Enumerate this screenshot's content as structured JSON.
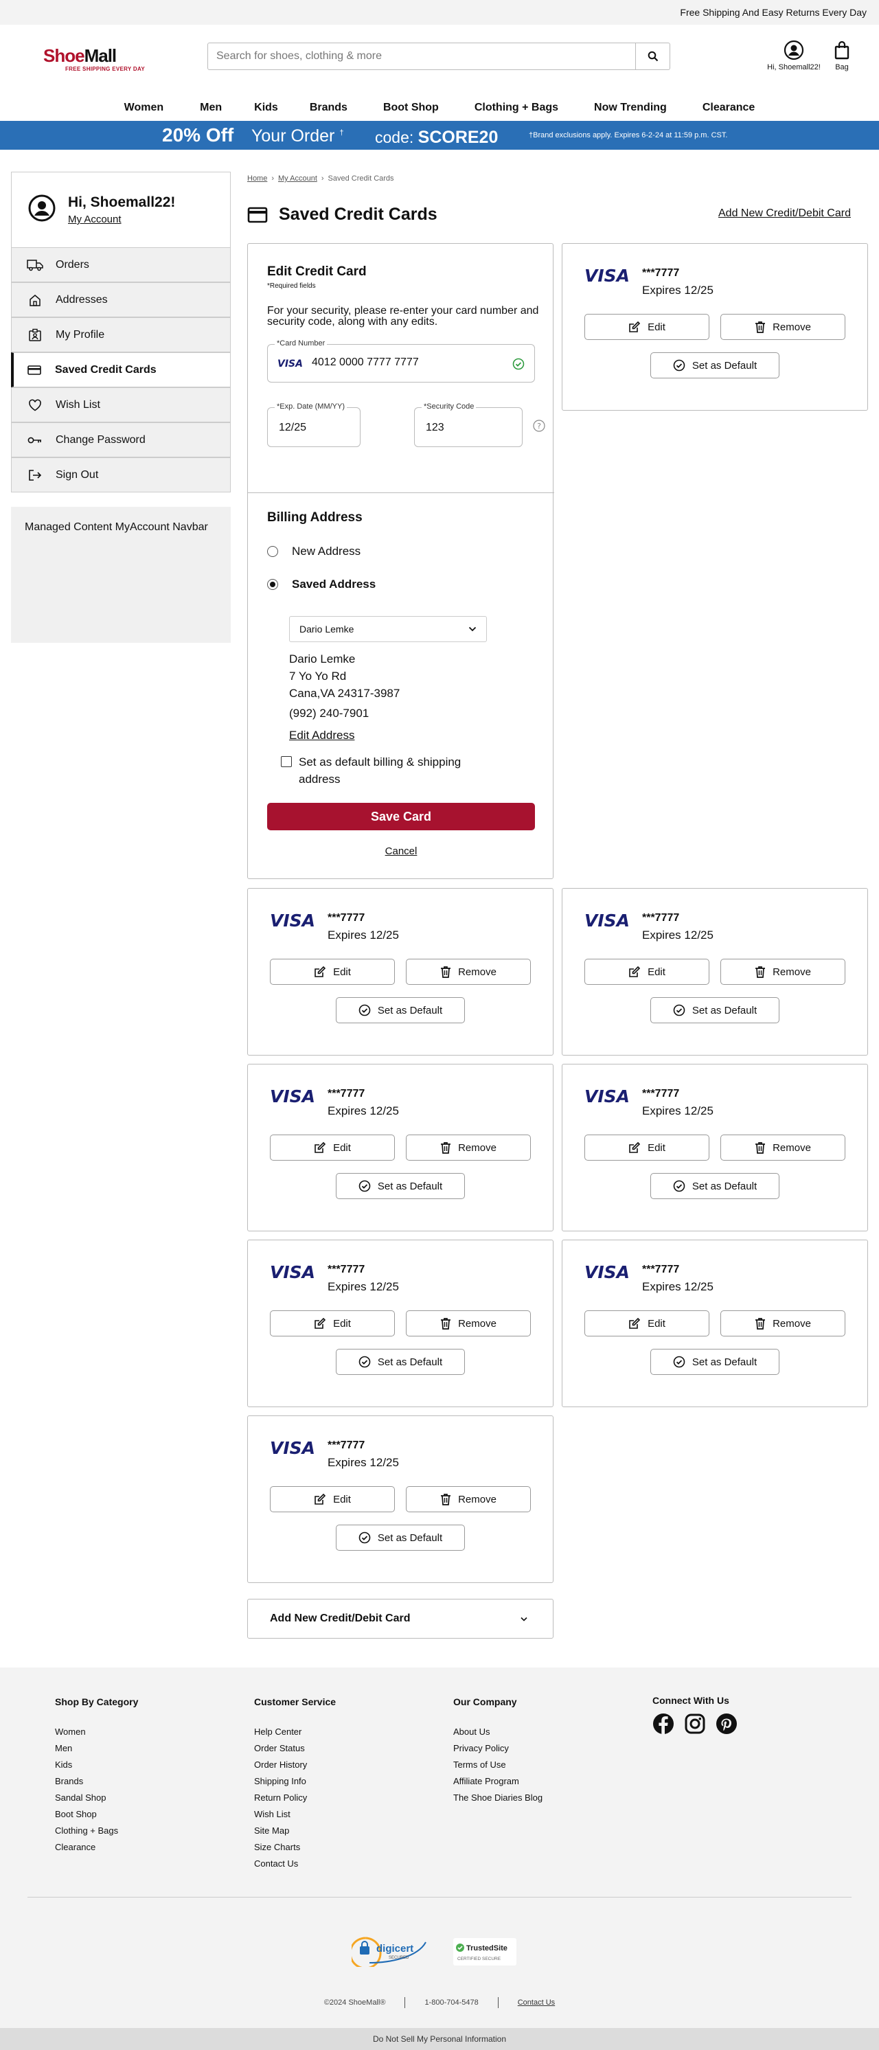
{
  "topbar": {
    "text": "Free Shipping And Easy Returns Every Day"
  },
  "logo": {
    "brand_a": "Shoe",
    "brand_b": "Mall",
    "tagline": "FREE SHIPPING EVERY DAY"
  },
  "search": {
    "placeholder": "Search for shoes, clothing & more"
  },
  "account": {
    "label": "Hi, Shoemall22!"
  },
  "bag": {
    "label": "Bag"
  },
  "nav": {
    "items": [
      "Women",
      "Men",
      "Kids",
      "Brands",
      "Boot Shop",
      "Clothing + Bags",
      "Now Trending",
      "Clearance"
    ]
  },
  "promo": {
    "off": "20% Off",
    "order": "Your Order",
    "dagger": "†",
    "code_label": "code:",
    "code": "SCORE20",
    "fine": "†Brand exclusions apply. Expires 6-2-24 at 11:59 p.m. CST."
  },
  "sidebar": {
    "greeting": "Hi, Shoemall22!",
    "my_account": "My Account",
    "items": [
      {
        "label": "Orders",
        "icon": "truck-icon"
      },
      {
        "label": "Addresses",
        "icon": "home-icon"
      },
      {
        "label": "My Profile",
        "icon": "id-badge-icon"
      },
      {
        "label": "Saved Credit Cards",
        "icon": "credit-card-icon",
        "active": true
      },
      {
        "label": "Wish List",
        "icon": "heart-icon"
      },
      {
        "label": "Change Password",
        "icon": "key-icon"
      },
      {
        "label": "Sign Out",
        "icon": "sign-out-icon"
      }
    ],
    "managed": "Managed Content MyAccount Navbar"
  },
  "breadcrumb": {
    "home": "Home",
    "account": "My Account",
    "current": "Saved Credit Cards"
  },
  "page": {
    "title": "Saved Credit Cards",
    "add_link": "Add New Credit/Debit Card"
  },
  "edit_card": {
    "title": "Edit Credit Card",
    "required": "*Required fields",
    "note": "For your security, please re-enter your card number and security code, along with any edits.",
    "card_number_label": "*Card Number",
    "card_number": "4012 0000 7777 7777",
    "exp_label": "*Exp. Date (MM/YY)",
    "exp": "12/25",
    "sec_label": "*Security Code",
    "sec": "123",
    "billing_title": "Billing Address",
    "new_address": "New Address",
    "saved_address": "Saved Address",
    "selected_address": "Dario Lemke",
    "address": {
      "name": "Dario Lemke",
      "street": "7 Yo Yo Rd",
      "city": "Cana,VA 24317-3987",
      "phone": "(992) 240-7901"
    },
    "edit_address": "Edit Address",
    "default_checkbox": "Set as default billing & shipping address",
    "save": "Save Card",
    "cancel": "Cancel"
  },
  "card_labels": {
    "edit": "Edit",
    "remove": "Remove",
    "default": "Set as Default",
    "brand": "VISA"
  },
  "cards": [
    {
      "number": "***7777",
      "expires": "Expires 12/25"
    },
    {
      "number": "***7777",
      "expires": "Expires 12/25"
    },
    {
      "number": "***7777",
      "expires": "Expires 12/25"
    },
    {
      "number": "***7777",
      "expires": "Expires 12/25"
    },
    {
      "number": "***7777",
      "expires": "Expires 12/25"
    },
    {
      "number": "***7777",
      "expires": "Expires 12/25"
    },
    {
      "number": "***7777",
      "expires": "Expires 12/25"
    },
    {
      "number": "***7777",
      "expires": "Expires 12/25"
    }
  ],
  "add_new_accordion": "Add New Credit/Debit Card",
  "footer": {
    "shop": {
      "title": "Shop By Category",
      "links": [
        "Women",
        "Men",
        "Kids",
        "Brands",
        "Sandal Shop",
        "Boot Shop",
        "Clothing + Bags",
        "Clearance"
      ]
    },
    "service": {
      "title": "Customer Service",
      "links": [
        "Help Center",
        "Order Status",
        "Order History",
        "Shipping Info",
        "Return Policy",
        "Wish List",
        "Site Map",
        "Size Charts",
        "Contact Us"
      ]
    },
    "company": {
      "title": "Our Company",
      "links": [
        "About Us",
        "Privacy Policy",
        "Terms of Use",
        "Affiliate Program",
        "The Shoe Diaries Blog"
      ]
    },
    "connect": {
      "title": "Connect With Us"
    },
    "digicert": {
      "name": "digicert",
      "sub": "SECURED"
    },
    "trusted": {
      "name": "TrustedSite",
      "sub": "CERTIFIED SECURE"
    },
    "copyright": "©2024 ShoeMall®",
    "phone": "1-800-704-5478",
    "contact": "Contact Us",
    "do_not_sell": "Do Not Sell My Personal Information"
  },
  "colors": {
    "brand_red": "#a7122f",
    "promo_blue": "#2a6fb6",
    "visa_blue": "#1a1f71"
  }
}
